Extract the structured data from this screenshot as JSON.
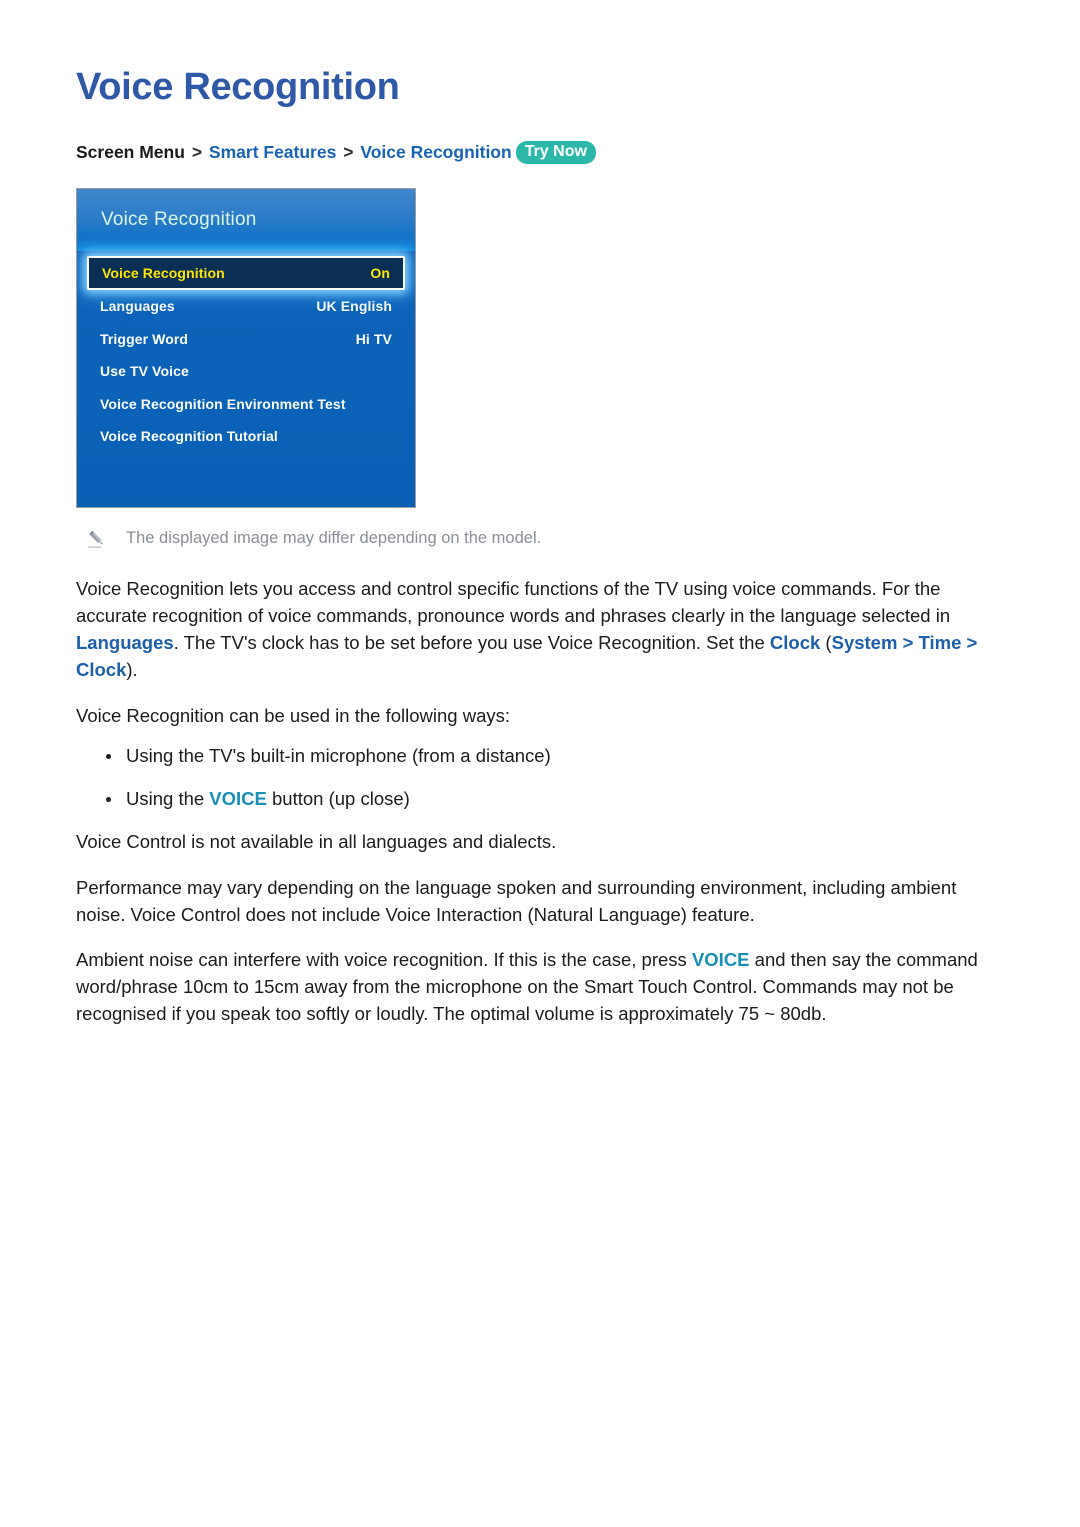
{
  "page": {
    "title": "Voice Recognition"
  },
  "breadcrumb": {
    "root": "Screen Menu",
    "separator": ">",
    "link1": "Smart Features",
    "link2": "Voice Recognition",
    "badge": "Try Now"
  },
  "tv_menu": {
    "header_title": "Voice Recognition",
    "rows": [
      {
        "label": "Voice Recognition",
        "value": "On",
        "selected": true
      },
      {
        "label": "Languages",
        "value": "UK English",
        "selected": false
      },
      {
        "label": "Trigger Word",
        "value": "Hi TV",
        "selected": false
      },
      {
        "label": "Use TV Voice",
        "value": "",
        "selected": false
      },
      {
        "label": "Voice Recognition Environment Test",
        "value": "",
        "selected": false
      },
      {
        "label": "Voice Recognition Tutorial",
        "value": "",
        "selected": false
      }
    ],
    "colors": {
      "panel_blue": "#0c62b8",
      "header_blue": "#2d7cc8",
      "selected_bg": "#0b2e55",
      "selected_text": "#ffe600",
      "header_text": "#d8f6e6"
    }
  },
  "note": {
    "icon": "pencil-icon",
    "text": "The displayed image may differ depending on the model."
  },
  "body": {
    "p1_part1": "Voice Recognition lets you access and control specific functions of the TV using voice commands. For the accurate recognition of voice commands, pronounce words and phrases clearly in the language selected in ",
    "p1_link_languages": "Languages",
    "p1_part2": ". The TV's clock has to be set before you use Voice Recognition. Set the ",
    "p1_link_clock": "Clock",
    "p1_part3": " (",
    "p1_link_system": "System",
    "p1_sep1": " > ",
    "p1_link_time": "Time",
    "p1_sep2": " > ",
    "p1_link_clock2": "Clock",
    "p1_part4": ").",
    "p2": "Voice Recognition can be used in the following ways:",
    "bullet1": "Using the TV's built-in microphone (from a distance)",
    "bullet2_part1": "Using the ",
    "bullet2_voice": "VOICE",
    "bullet2_part2": " button (up close)",
    "p3": "Voice Control is not available in all languages and dialects.",
    "p4": "Performance may vary depending on the language spoken and surrounding environment, including ambient noise. Voice Control does not include Voice Interaction (Natural Language) feature.",
    "p5_part1": "Ambient noise can interfere with voice recognition. If this is the case, press ",
    "p5_voice": "VOICE",
    "p5_part2": " and then say the command word/phrase 10cm to 15cm away from the microphone on the Smart Touch Control. Commands may not be recognised if you speak too softly or loudly. The optimal volume is approximately 75 ~ 80db."
  },
  "colors": {
    "title_blue": "#2f58a7",
    "link_blue": "#1d5fa8",
    "voice_cyan": "#1a8fb5",
    "badge_teal": "#2cb8a8",
    "note_gray": "#8a8f99"
  }
}
